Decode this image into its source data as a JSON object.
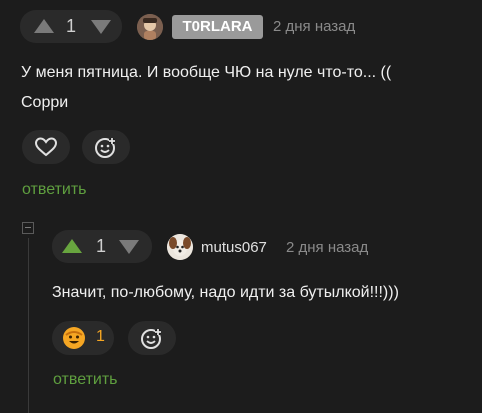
{
  "colors": {
    "background": "#1c1c1c",
    "pill": "#2a2a2a",
    "reply_link": "#5f9f3f",
    "upvote_active": "#68a53f",
    "badge_bg": "#9a9a9a"
  },
  "comment1": {
    "vote_count": "1",
    "username": "T0RLARA",
    "date": "2 дня назад",
    "text_line1": "У меня пятница. И вообще ЧЮ на нуле что-то... ((",
    "text_line2": "Сорри",
    "reply_label": "ответить",
    "icons": [
      "arrow-up-icon",
      "arrow-down-icon",
      "avatar",
      "heart-icon",
      "add-reaction-icon"
    ]
  },
  "comment2": {
    "vote_count": "1",
    "username": "mutus067",
    "date": "2 дня назад",
    "text": "Значит, по-любому, надо идти за бутылкой!!!)))",
    "reaction_count": "1",
    "reply_label": "ответить",
    "icons": [
      "arrow-up-icon",
      "arrow-down-icon",
      "avatar",
      "smile-reaction-icon",
      "add-reaction-icon",
      "collapse-thread-icon"
    ]
  }
}
